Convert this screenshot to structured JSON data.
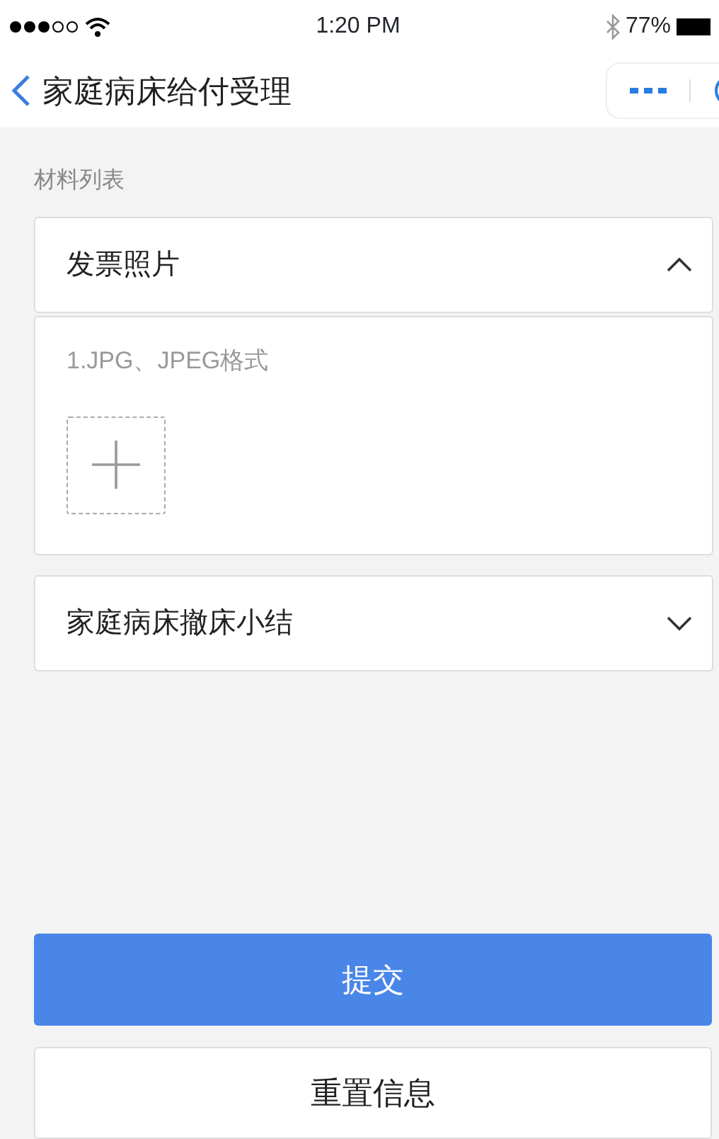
{
  "status_bar": {
    "time": "1:20 PM",
    "battery": "77%"
  },
  "header": {
    "title": "家庭病床给付受理"
  },
  "section_label": "材料列表",
  "materials": [
    {
      "title": "发票照片",
      "expanded": true,
      "hint": "1.JPG、JPEG格式"
    },
    {
      "title": "家庭病床撤床小结",
      "expanded": false
    }
  ],
  "buttons": [
    {
      "label": "提交",
      "kind": "primary"
    },
    {
      "label": "重置信息",
      "kind": "secondary"
    }
  ]
}
